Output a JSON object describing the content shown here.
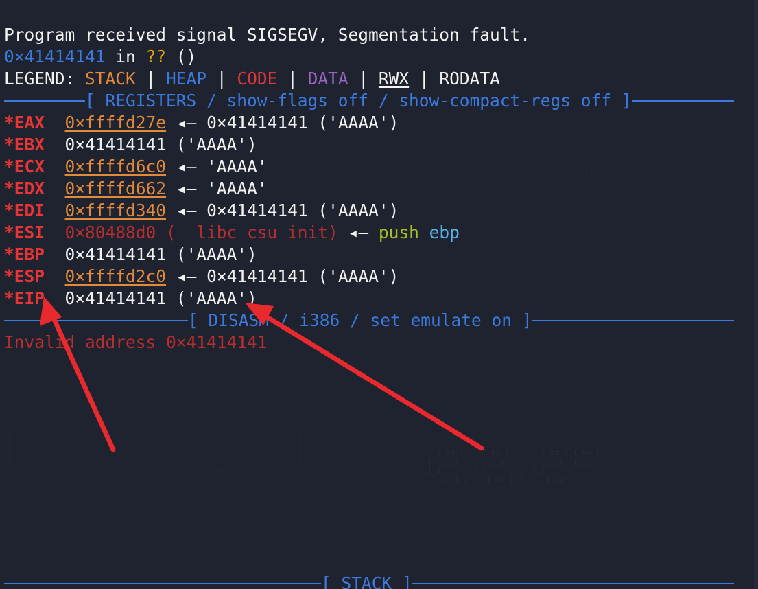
{
  "signal_line": "Program received signal SIGSEGV, Segmentation fault.",
  "location": {
    "addr": "0×41414141",
    "in": " in ",
    "func": "??",
    "args": " ()"
  },
  "legend": {
    "prefix": "LEGEND: ",
    "stack": "STACK",
    "heap": "HEAP",
    "code": "CODE",
    "data": "DATA",
    "rwx": "RWX",
    "rodata": "RODATA",
    "bar": " | "
  },
  "sections": {
    "registers": "[ REGISTERS / show-flags off / show-compact-regs off ]",
    "disasm": "[ DISASM / i386 / set emulate on ]",
    "stack": "[ STACK ]"
  },
  "registers": [
    {
      "star": "*",
      "name": "EAX",
      "value": "0×ffffd27e",
      "arrow": " ◂— ",
      "target": "0×41414141 ('AAAA')"
    },
    {
      "star": "*",
      "name": "EBX",
      "value": "0×41414141 ('AAAA')"
    },
    {
      "star": "*",
      "name": "ECX",
      "value": "0×ffffd6c0",
      "arrow": " ◂— ",
      "target": "'AAAA'"
    },
    {
      "star": "*",
      "name": "EDX",
      "value": "0×ffffd662",
      "arrow": " ◂— ",
      "target": "'AAAA'"
    },
    {
      "star": "*",
      "name": "EDI",
      "value": "0×ffffd340",
      "arrow": " ◂— ",
      "target": "0×41414141 ('AAAA')"
    },
    {
      "star": "*",
      "name": "ESI",
      "value": "0×80488d0 (__libc_csu_init)",
      "arrow": " ◂— ",
      "op": "push",
      "operand": " ebp"
    },
    {
      "star": "*",
      "name": "EBP",
      "value": "0×41414141 ('AAAA')"
    },
    {
      "star": "*",
      "name": "ESP",
      "value": "0×ffffd2c0",
      "arrow": " ◂— ",
      "target": "0×41414141 ('AAAA')"
    },
    {
      "star": "*",
      "name": "EIP",
      "value": "0×41414141 ('AAAA')"
    }
  ],
  "disasm_error": "Invalid address 0×41414141",
  "colors": {
    "background": "#1f222f",
    "register_name": "#e53535",
    "stack": "#e18a3b",
    "heap": "#3b7bde",
    "code": "#d83a3a",
    "data": "#9a63c4",
    "annotation_arrow": "#e8292e"
  }
}
